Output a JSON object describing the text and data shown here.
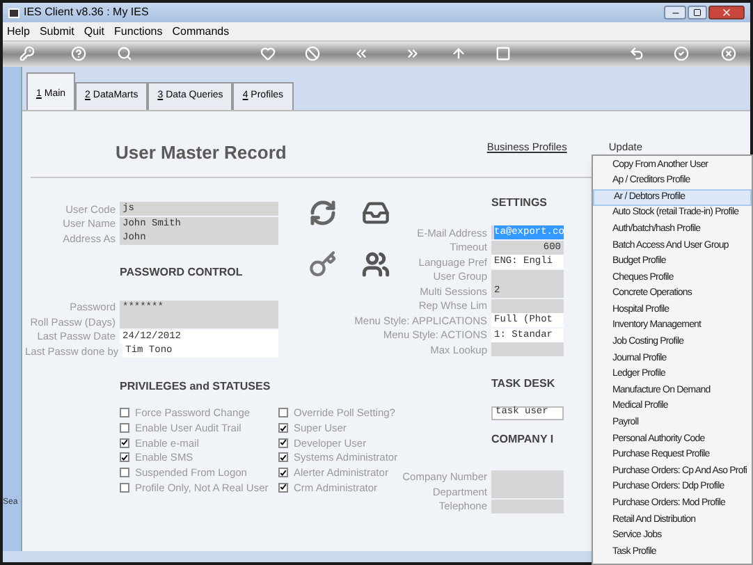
{
  "window": {
    "title": "IES Client v8.36 : My IES"
  },
  "menu_bar": [
    "Help",
    "Submit",
    "Quit",
    "Functions",
    "Commands"
  ],
  "tabs": [
    {
      "hotkey": "1",
      "label": "Main",
      "selected": true
    },
    {
      "hotkey": "2",
      "label": "DataMarts",
      "selected": false
    },
    {
      "hotkey": "3",
      "label": "Data Queries",
      "selected": false
    },
    {
      "hotkey": "4",
      "label": "Profiles",
      "selected": false
    }
  ],
  "heading": "User Master Record",
  "top_links": [
    "Business Profiles",
    "Update"
  ],
  "user_fields": [
    {
      "label": "User Code",
      "value": "js",
      "kind": "grey"
    },
    {
      "label": "User Name",
      "value": "John Smith",
      "kind": "grey"
    },
    {
      "label": "Address As",
      "value": "John",
      "kind": "grey"
    }
  ],
  "password_control": {
    "title": "PASSWORD CONTROL",
    "fields": [
      {
        "label": "Password",
        "value": "*******",
        "kind": "grey"
      },
      {
        "label": "Roll Passw (Days)",
        "kind": "grey"
      },
      {
        "label": "Last Passw Date",
        "value": "24/12/2012",
        "kind": "white"
      },
      {
        "label": "Last Passw done by",
        "value": "Tim Tono",
        "kind": "white"
      }
    ]
  },
  "privileges": {
    "title": "PRIVILEGES and STATUSES",
    "left": [
      {
        "label": "Force Password Change",
        "checked": false
      },
      {
        "label": "Enable User Audit Trail",
        "checked": false
      },
      {
        "label": "Enable e-mail",
        "checked": true
      },
      {
        "label": "Enable SMS",
        "checked": true
      },
      {
        "label": "Suspended From Logon",
        "checked": false
      },
      {
        "label": "Profile Only, Not A Real User",
        "checked": false
      }
    ],
    "right": [
      {
        "label": "Override Poll Setting?",
        "checked": false
      },
      {
        "label": "Super User",
        "checked": true
      },
      {
        "label": "Developer User",
        "checked": true
      },
      {
        "label": "Systems Administrator",
        "checked": true
      },
      {
        "label": "Alerter Administrator",
        "checked": true
      },
      {
        "label": "Crm Administrator",
        "checked": true
      }
    ]
  },
  "settings": {
    "title": "SETTINGS",
    "fields": [
      {
        "label": "E-Mail Address",
        "value": "ta@export.co",
        "kind": "highlighted"
      },
      {
        "label": "Timeout",
        "value": "600",
        "kind": "grey"
      },
      {
        "label": "Language Pref",
        "value": "ENG: Engli",
        "kind": "white"
      },
      {
        "label": "User Group",
        "kind": "grey"
      },
      {
        "label": "Multi Sessions",
        "value": "2",
        "kind": "grey"
      },
      {
        "label": "Rep Whse Lim",
        "kind": "grey"
      },
      {
        "label": "Menu Style: APPLICATIONS",
        "value": "Full (Phot",
        "kind": "white"
      },
      {
        "label": "Menu Style: ACTIONS",
        "value": "1: Standar",
        "kind": "white"
      },
      {
        "label": "Max Lookup",
        "kind": "grey"
      }
    ]
  },
  "task_desk": {
    "title": "TASK DESK",
    "value": "task user"
  },
  "company": {
    "title": "COMPANY I",
    "fields": [
      {
        "label": "Company Number",
        "kind": "grey"
      },
      {
        "label": "Department",
        "kind": "grey"
      },
      {
        "label": "Telephone",
        "kind": "grey"
      }
    ]
  },
  "side_panel": {
    "label": "Sea"
  },
  "dropdown": {
    "items": [
      {
        "label": "Copy From Another User",
        "selected": false
      },
      {
        "label": "Ap / Creditors Profile",
        "selected": false
      },
      {
        "label": "Ar / Debtors Profile",
        "selected": true
      },
      {
        "label": "Auto Stock (retail Trade-in) Profile",
        "selected": false
      },
      {
        "label": "Auth/batch/hash Profile",
        "selected": false
      },
      {
        "label": "Batch Access And User Group",
        "selected": false
      },
      {
        "label": "Budget Profile",
        "selected": false
      },
      {
        "label": "Cheques Profile",
        "selected": false
      },
      {
        "label": "Concrete Operations",
        "selected": false
      },
      {
        "label": "Hospital Profile",
        "selected": false
      },
      {
        "label": "Inventory Management",
        "selected": false
      },
      {
        "label": "Job Costing Profile",
        "selected": false
      },
      {
        "label": "Journal Profile",
        "selected": false
      },
      {
        "label": "Ledger Profile",
        "selected": false
      },
      {
        "label": "Manufacture On Demand",
        "selected": false
      },
      {
        "label": "Medical Profile",
        "selected": false
      },
      {
        "label": "Payroll",
        "selected": false
      },
      {
        "label": "Personal Authority Code",
        "selected": false
      },
      {
        "label": "Purchase Request Profile",
        "selected": false
      },
      {
        "label": "Purchase Orders: Cp And Aso Profi",
        "selected": false
      },
      {
        "label": "Purchase Orders: Ddp Profile",
        "selected": false
      },
      {
        "label": "Purchase Orders: Mod Profile",
        "selected": false
      },
      {
        "label": "Retail And Distribution",
        "selected": false
      },
      {
        "label": "Service Jobs",
        "selected": false
      },
      {
        "label": "Task Profile",
        "selected": false
      }
    ]
  }
}
